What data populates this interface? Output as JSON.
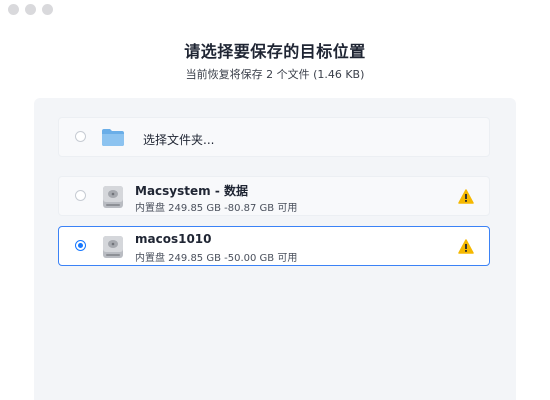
{
  "dialog": {
    "title": "请选择要保存的目标位置",
    "subtitle": "当前恢复将保存 2 个文件 (1.46 KB)"
  },
  "folder_option": {
    "label": "选择文件夹...",
    "icon": "folder-icon",
    "selected": false
  },
  "disks": [
    {
      "name": "Macsystem - 数据",
      "info": "内置盘 249.85 GB -80.87 GB 可用",
      "icon": "hard-disk-icon",
      "warning": true,
      "selected": false
    },
    {
      "name": "macos1010",
      "info": "内置盘 249.85 GB -50.00 GB 可用",
      "icon": "hard-disk-icon",
      "warning": true,
      "selected": true
    }
  ],
  "colors": {
    "accent": "#1677ff",
    "selected_border": "#3b82f6",
    "warning": "#f5b800",
    "folder": "#6aaee8"
  }
}
